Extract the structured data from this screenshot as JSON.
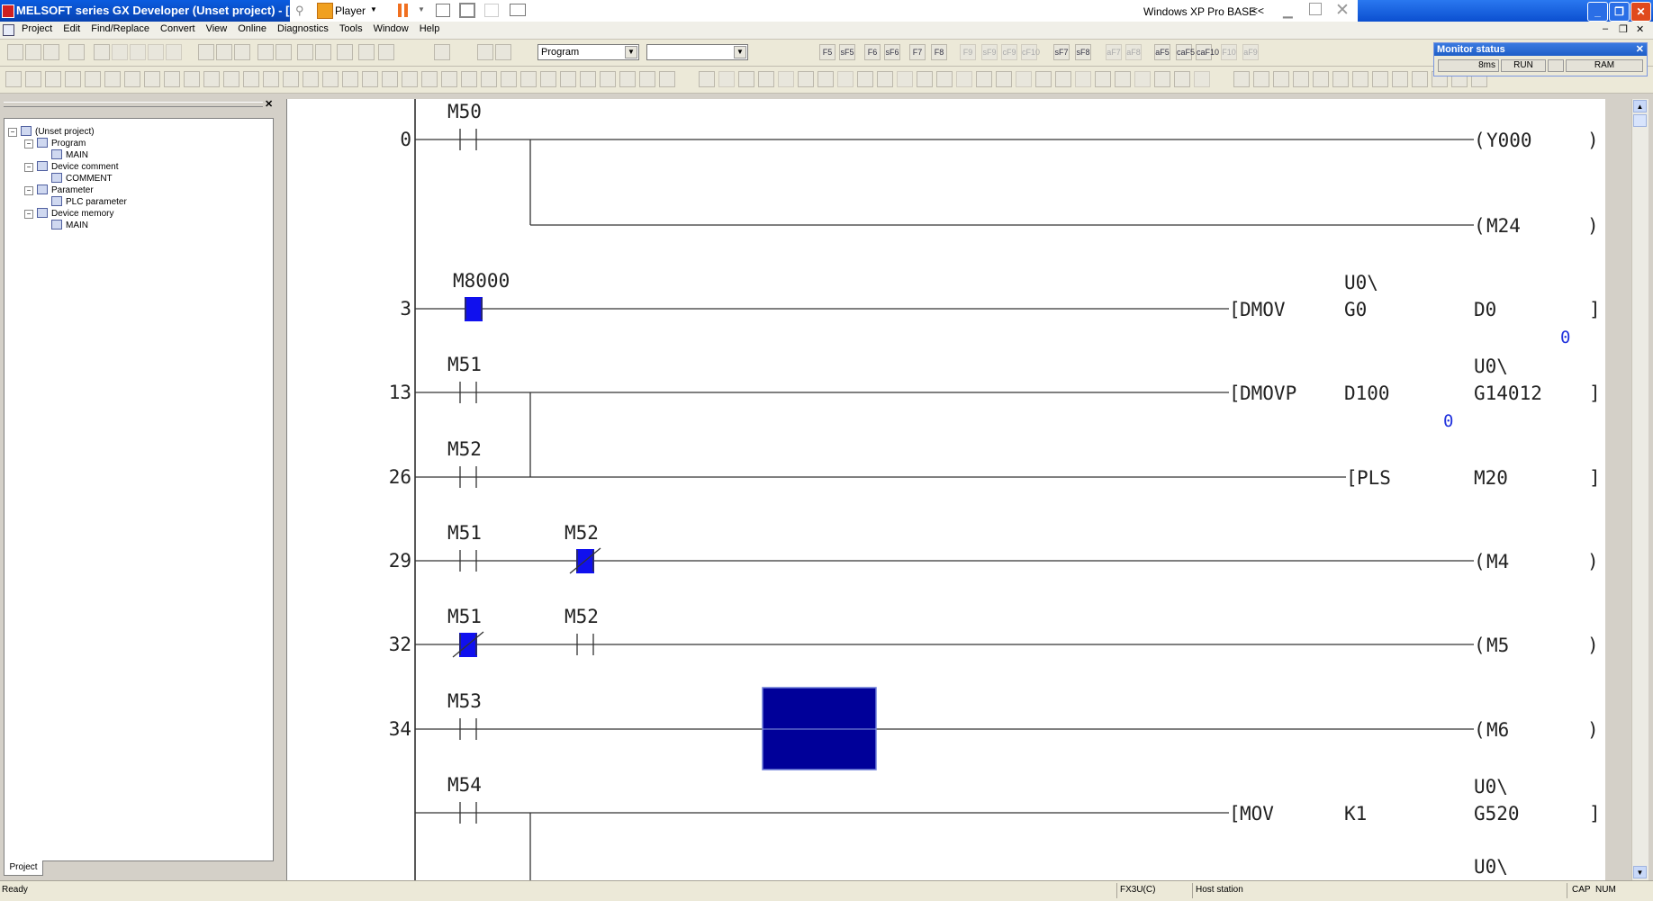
{
  "window": {
    "title": "MELSOFT series GX Developer (Unset project) - [LD",
    "player_label": "Player",
    "remote_label": "Windows XP Pro  BASE",
    "remote_arrow": "<<"
  },
  "menu": [
    "Project",
    "Edit",
    "Find/Replace",
    "Convert",
    "View",
    "Online",
    "Diagnostics",
    "Tools",
    "Window",
    "Help"
  ],
  "toolbar": {
    "program_combo": "Program",
    "second_combo": "",
    "fkeys": [
      "F5",
      "sF5",
      "F6",
      "sF6",
      "F7",
      "F8",
      "F9",
      "sF9",
      "cF9",
      "cF10",
      "sF7",
      "sF8",
      "aF7",
      "aF8",
      "aF5",
      "caF5",
      "caF10",
      "F10",
      "aF9"
    ]
  },
  "monitor_status": {
    "title": "Monitor status",
    "scan_time": "8ms",
    "run_state": "RUN",
    "memory": "RAM"
  },
  "project_tree": {
    "root": "(Unset project)",
    "nodes": [
      {
        "label": "Program",
        "depth": 1
      },
      {
        "label": "MAIN",
        "depth": 2
      },
      {
        "label": "Device comment",
        "depth": 1
      },
      {
        "label": "COMMENT",
        "depth": 2
      },
      {
        "label": "Parameter",
        "depth": 1
      },
      {
        "label": "PLC parameter",
        "depth": 2
      },
      {
        "label": "Device memory",
        "depth": 1
      },
      {
        "label": "MAIN",
        "depth": 2
      }
    ],
    "tab_label": "Project"
  },
  "ladder": {
    "step_numbers": [
      "0",
      "3",
      "13",
      "26",
      "29",
      "32",
      "34"
    ],
    "contacts": [
      "M50",
      "M8000",
      "M51",
      "M52",
      "M51",
      "M52",
      "M51",
      "M52",
      "M53",
      "M54"
    ],
    "coils": [
      "Y000",
      "M24",
      "M4",
      "M5",
      "M6"
    ],
    "instructions": {
      "dmov": [
        "DMOV",
        "U0\\",
        "G0",
        "D0"
      ],
      "dmovp": [
        "DMOVP",
        "D100",
        "U0\\",
        "G14012"
      ],
      "pls": [
        "PLS",
        "M20"
      ],
      "mov": [
        "MOV",
        "K1",
        "U0\\",
        "G520"
      ],
      "trailing": "U0\\"
    },
    "monitor_values": [
      "0",
      "0"
    ]
  },
  "status_bar": {
    "ready": "Ready",
    "cpu": "FX3U(C)",
    "station": "Host station",
    "cap": "CAP",
    "num": "NUM"
  }
}
